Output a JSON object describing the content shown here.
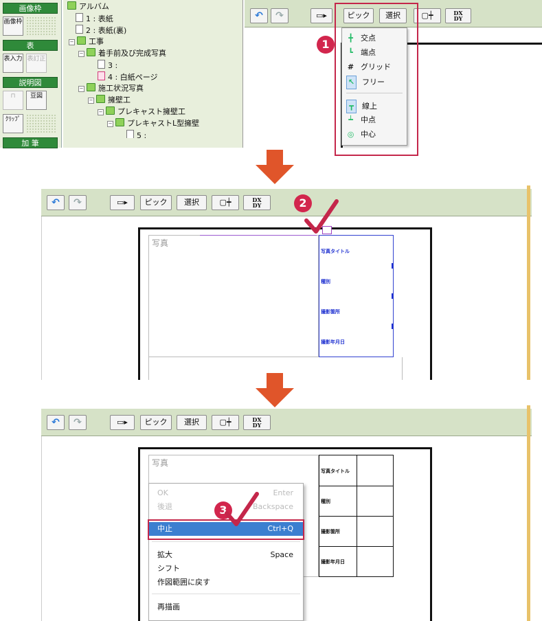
{
  "panel1": {
    "sidebar": {
      "image_frame_header": "画像枠",
      "image_frame_btn": "画像枠",
      "table_header": "表",
      "table_input_btn": "表入力",
      "table_edit_btn": "表訂正",
      "figure_header": "説明図",
      "bean_btn": "豆図",
      "clip_btn": "ｸﾘｯﾌﾟ",
      "add_header": "加 筆"
    },
    "tree": {
      "items": [
        {
          "label": "アルバム"
        },
        {
          "label": "1 : 表紙"
        },
        {
          "label": "2 : 表紙(裏)"
        },
        {
          "label": "工事"
        },
        {
          "label": "着手前及び完成写真"
        },
        {
          "label": "3 :"
        },
        {
          "label": "4 : 白紙ページ"
        },
        {
          "label": "施工状況写真"
        },
        {
          "label": "擁壁工"
        },
        {
          "label": "プレキャスト擁壁工"
        },
        {
          "label": "プレキャストL型擁壁"
        },
        {
          "label": "5 :"
        }
      ]
    },
    "toolbar": {
      "pick": "ピック",
      "select": "選択",
      "dx": "DX",
      "dy": "DY"
    },
    "pick_menu": {
      "items": [
        {
          "label": "交点",
          "icon": "intersection-icon"
        },
        {
          "label": "端点",
          "icon": "endpoint-icon"
        },
        {
          "label": "グリッド",
          "icon": "grid-icon"
        },
        {
          "label": "フリー",
          "icon": "free-icon"
        },
        {
          "label": "線上",
          "icon": "on-line-icon"
        },
        {
          "label": "中点",
          "icon": "midpoint-icon"
        },
        {
          "label": "中心",
          "icon": "center-icon"
        }
      ]
    },
    "step_badge": "1"
  },
  "panel2": {
    "toolbar": {
      "pick": "ピック",
      "select": "選択",
      "dx": "DX",
      "dy": "DY"
    },
    "photo_label": "写真",
    "fields": [
      "写真タイトル",
      "種別",
      "撮影箇所",
      "撮影年月日"
    ],
    "step_badge": "2"
  },
  "panel3": {
    "toolbar": {
      "pick": "ピック",
      "select": "選択",
      "dx": "DX",
      "dy": "DY"
    },
    "photo_label": "写真",
    "fields": [
      "写真タイトル",
      "種別",
      "撮影箇所",
      "撮影年月日"
    ],
    "context_menu": {
      "ok": "OK",
      "ok_key": "Enter",
      "back": "後退",
      "back_key": "Backspace",
      "cancel": "中止",
      "cancel_key": "Ctrl+Q",
      "zoom": "拡大",
      "zoom_key": "Space",
      "shift": "シフト",
      "restore": "作図範囲に戻す",
      "redraw": "再描画"
    },
    "step_badge": "3"
  },
  "colors": {
    "accent_red": "#c4264a",
    "arrow_orange": "#e0552a",
    "side_green": "#2f8a3a"
  }
}
